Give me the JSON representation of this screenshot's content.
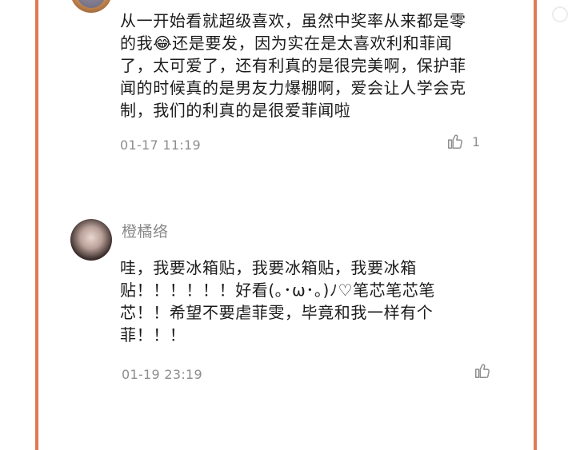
{
  "colors": {
    "border": "#e07a52",
    "text": "#1b1b1b",
    "meta": "#8e8e8e"
  },
  "comments": [
    {
      "username": "",
      "text": "从一开始看就超级喜欢，虽然中奖率从来都是零的我😂还是要发，因为实在是太喜欢利和菲闻了，太可爱了，还有利真的是很完美啊，保护菲闻的时候真的是男友力爆棚啊，爱会让人学会克制，我们的利真的是很爱菲闻啦",
      "time": "01-17 11:19",
      "likes": "1",
      "like_icon": "thumbs-up-icon"
    },
    {
      "username": "橙橘络",
      "text": "哇，我要冰箱贴，我要冰箱贴，我要冰箱贴！！！！！！好看(｡･ω･｡)ﾉ♡笔芯笔芯笔芯！！希望不要虐菲雯，毕竟和我一样有个菲！！！",
      "time": "01-19 23:19",
      "likes": "",
      "like_icon": "thumbs-up-icon"
    }
  ]
}
